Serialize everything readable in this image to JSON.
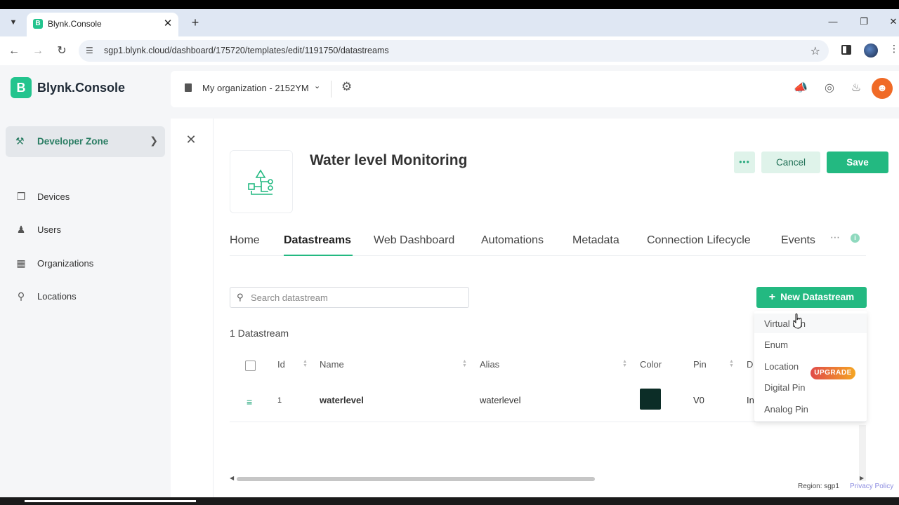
{
  "browser": {
    "tab_title": "Blynk.Console",
    "favicon_letter": "B",
    "url": "sgp1.blynk.cloud/dashboard/175720/templates/edit/1191750/datastreams"
  },
  "app": {
    "logo_letter": "B",
    "logo_text": "Blynk.Console",
    "org_name": "My organization - 2152YM"
  },
  "sidebar": {
    "developer_zone": "Developer Zone",
    "items": [
      {
        "label": "Devices"
      },
      {
        "label": "Users"
      },
      {
        "label": "Organizations"
      },
      {
        "label": "Locations"
      }
    ]
  },
  "template": {
    "title": "Water level Monitoring",
    "more_label": "•••",
    "cancel_label": "Cancel",
    "save_label": "Save"
  },
  "tabs": [
    "Home",
    "Datastreams",
    "Web Dashboard",
    "Automations",
    "Metadata",
    "Connection Lifecycle",
    "Events"
  ],
  "active_tab": "Datastreams",
  "search": {
    "placeholder": "Search datastream",
    "value": ""
  },
  "new_datastream_label": "New Datastream",
  "datastream_count": "1 Datastream",
  "table": {
    "headers": [
      "Id",
      "Name",
      "Alias",
      "Color",
      "Pin",
      "D"
    ],
    "rows": [
      {
        "id": "1",
        "name": "waterlevel",
        "alias": "waterlevel",
        "color": "#0c2d27",
        "pin": "V0",
        "data_type": "In"
      }
    ]
  },
  "dropdown": {
    "options": [
      "Virtual Pin",
      "Enum",
      "Location",
      "Digital Pin",
      "Analog Pin"
    ],
    "upgrade_badge": "UPGRADE"
  },
  "footer": {
    "region": "Region: sgp1",
    "privacy": "Privacy Policy"
  },
  "colors": {
    "accent": "#23b981",
    "accent_light": "#dff3ea",
    "swatch": "#0c2d27"
  }
}
